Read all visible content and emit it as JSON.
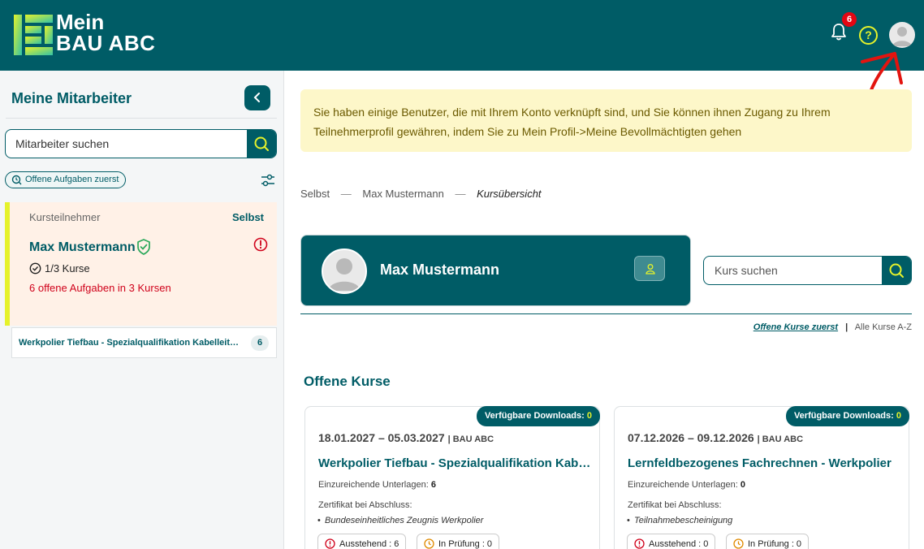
{
  "header": {
    "logo_line1": "Mein",
    "logo_line2": "BAU ABC",
    "notification_count": "6",
    "help_icon": "question-circle-icon",
    "bell_icon": "bell-icon",
    "avatar_icon": "user-avatar-icon"
  },
  "sidebar": {
    "title": "Meine Mitarbeiter",
    "search_placeholder": "Mitarbeiter suchen",
    "filter_chip": "Offene Aufgaben zuerst",
    "employee": {
      "role": "Kursteilnehmer",
      "self": "Selbst",
      "name": "Max Mustermann",
      "courses": "1/3 Kurse",
      "open_tasks": "6 offene Aufgaben in 3 Kursen"
    },
    "course_strip": {
      "name": "Werkpolier Tiefbau - Spezialqualifikation Kabelleitungstiefbau",
      "count": "6"
    }
  },
  "notice": {
    "text": "Sie haben einige Benutzer, die mit Ihrem Konto verknüpft sind, und Sie können ihnen Zugang zu Ihrem Teilnehmerprofil gewähren, indem Sie zu Mein Profil->Meine Bevollmächtigten gehen"
  },
  "breadcrumb": {
    "items": [
      "Selbst",
      "Max Mustermann",
      "Kursübersicht"
    ],
    "separator": "—"
  },
  "profile": {
    "name": "Max Mustermann"
  },
  "course_search": {
    "placeholder": "Kurs suchen"
  },
  "sort": {
    "active": "Offene Kurse zuerst",
    "separator": "|",
    "other": "Alle Kurse A-Z"
  },
  "section_title": "Offene Kurse",
  "cards": [
    {
      "downloads_label": "Verfügbare Downloads:",
      "downloads_value": "0",
      "dates": "18.01.2027 – 05.03.2027",
      "location": "| BAU ABC",
      "title": "Werkpolier Tiefbau - Spezialqualifikation Kabelleitungstiefbau",
      "docs_label": "Einzureichende Unterlagen:",
      "docs_value": "6",
      "cert_label": "Zertifikat bei Abschluss:",
      "cert_item": "Bundeseinheitliches Zeugnis Werkpolier",
      "status_pending": "Ausstehend : 6",
      "status_review": "In Prüfung : 0"
    },
    {
      "downloads_label": "Verfügbare Downloads:",
      "downloads_value": "0",
      "dates": "07.12.2026 – 09.12.2026",
      "location": "| BAU ABC",
      "title": "Lernfeldbezogenes Fachrechnen - Werkpolier",
      "docs_label": "Einzureichende Unterlagen:",
      "docs_value": "0",
      "cert_label": "Zertifikat bei Abschluss:",
      "cert_item": "Teilnahmebescheinigung",
      "status_pending": "Ausstehend : 0",
      "status_review": "In Prüfung : 0"
    }
  ],
  "colors": {
    "brand": "#005c66",
    "accent": "#e5f22b",
    "alert": "#e30613",
    "notice_bg": "#fdf7c9"
  }
}
